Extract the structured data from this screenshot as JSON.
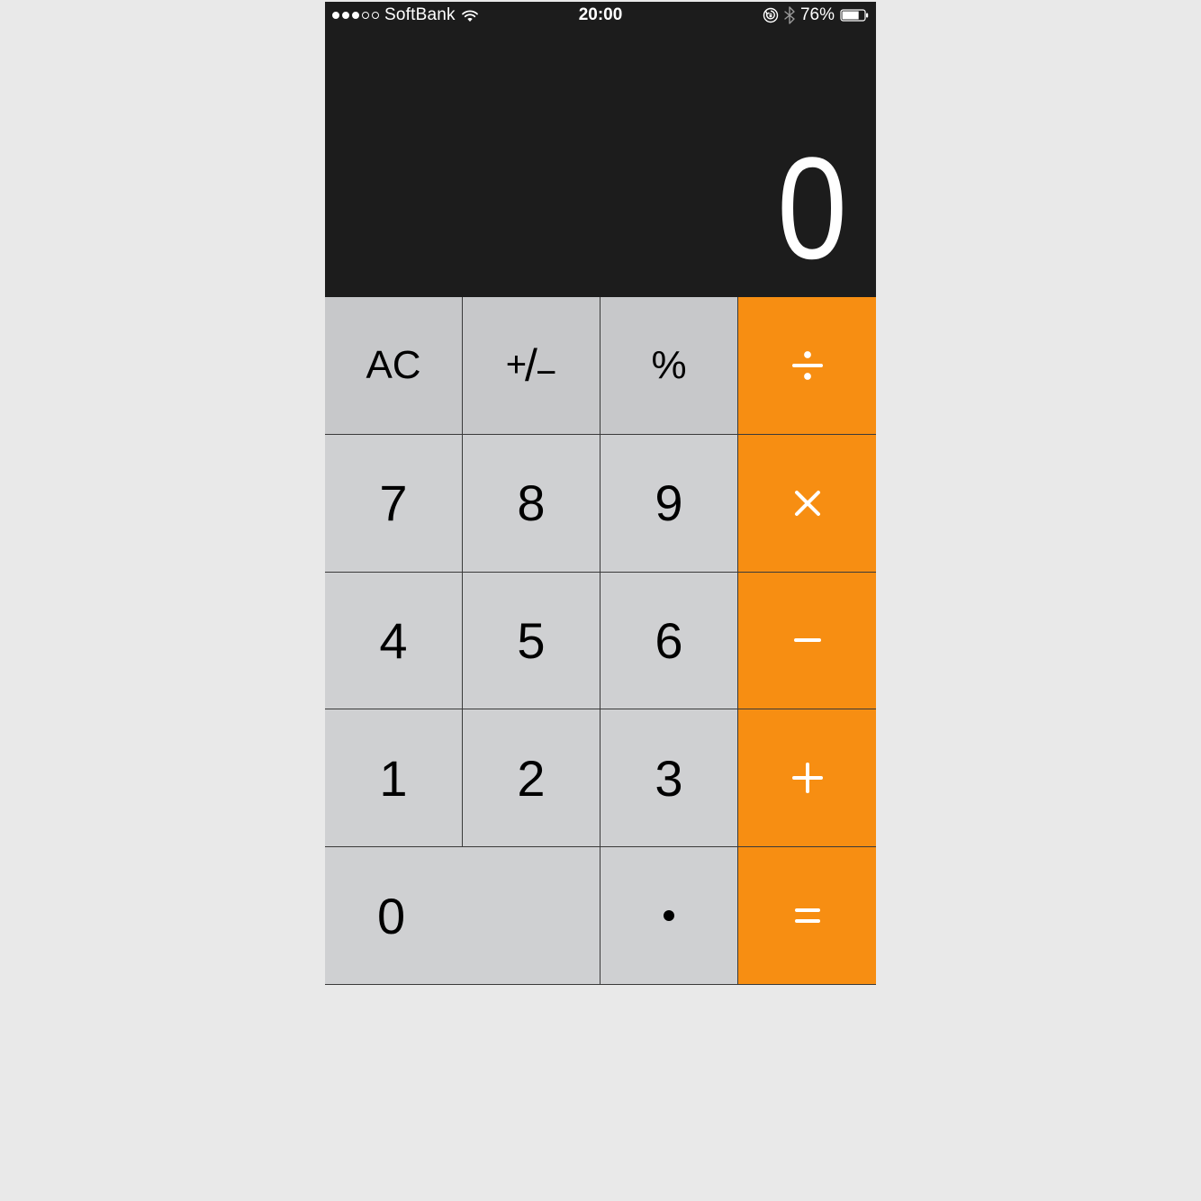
{
  "status": {
    "signal_filled": 3,
    "signal_total": 5,
    "carrier": "SoftBank",
    "time": "20:00",
    "battery_text": "76%"
  },
  "display": {
    "value": "0"
  },
  "keys": {
    "ac": "AC",
    "plusminus_plus": "+",
    "plusminus_slash": "/",
    "plusminus_minus": "−",
    "percent": "%",
    "divide": "÷",
    "multiply": "×",
    "minus": "−",
    "plus": "+",
    "equals": "=",
    "decimal": ".",
    "n0": "0",
    "n1": "1",
    "n2": "2",
    "n3": "3",
    "n4": "4",
    "n5": "5",
    "n6": "6",
    "n7": "7",
    "n8": "8",
    "n9": "9"
  }
}
